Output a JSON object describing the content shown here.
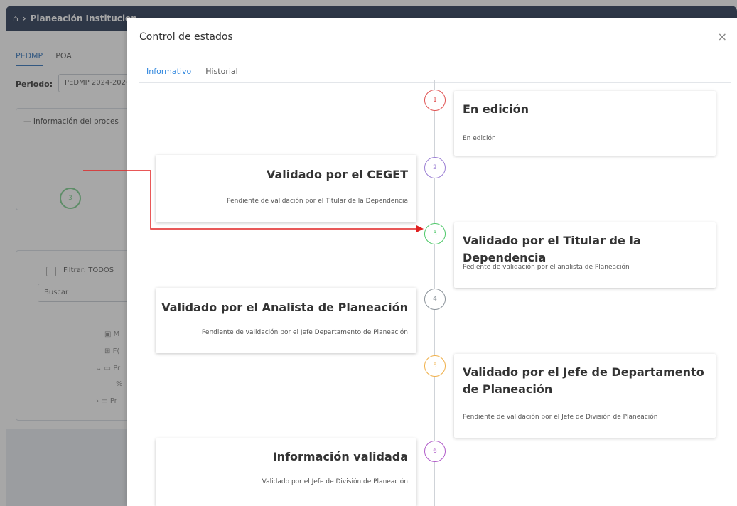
{
  "background": {
    "breadcrumb": "Planeación Institucion",
    "tabs": [
      "PEDMP",
      "POA"
    ],
    "periodo_label": "Periodo:",
    "periodo_value": "PEDMP 2024-2026",
    "info_header": "Información del proces",
    "step_number": "3",
    "filter_label": "Filtrar: TODOS",
    "search_placeholder": "Buscar",
    "tree_items": [
      "M",
      "F(",
      "Pr",
      "%",
      "Pr"
    ]
  },
  "modal": {
    "title": "Control de estados",
    "close_glyph": "×",
    "tabs": [
      {
        "label": "Informativo",
        "active": true
      },
      {
        "label": "Historial",
        "active": false
      }
    ]
  },
  "timeline": [
    {
      "step": "1",
      "title": "En edición",
      "description": "En edición",
      "color": "#e05252",
      "side": "right"
    },
    {
      "step": "2",
      "title": "Validado por el CEGET",
      "description": "Pendiente de validación por el Titular de la Dependencia",
      "color": "#9b7fd4",
      "side": "left"
    },
    {
      "step": "3",
      "title": "Validado por el Titular de la Dependencia",
      "description": "Pediente de validación por el analista de Planeación",
      "color": "#4fc86a",
      "side": "right"
    },
    {
      "step": "4",
      "title": "Validado por el Analista de Planeación",
      "description": "Pendiente de validación por el Jefe Departamento de Planeación",
      "color": "#8a9299",
      "side": "left"
    },
    {
      "step": "5",
      "title": "Validado por el Jefe de Departamento de Planeación",
      "description": "Pendiente de validación por el Jefe de División de Planeación",
      "color": "#f0b04a",
      "side": "right"
    },
    {
      "step": "6",
      "title": "Información validada",
      "description": "Validado por el Jefe de División de Planeación",
      "color": "#b05cc9",
      "side": "left"
    }
  ],
  "annotation_color": "#e02020"
}
